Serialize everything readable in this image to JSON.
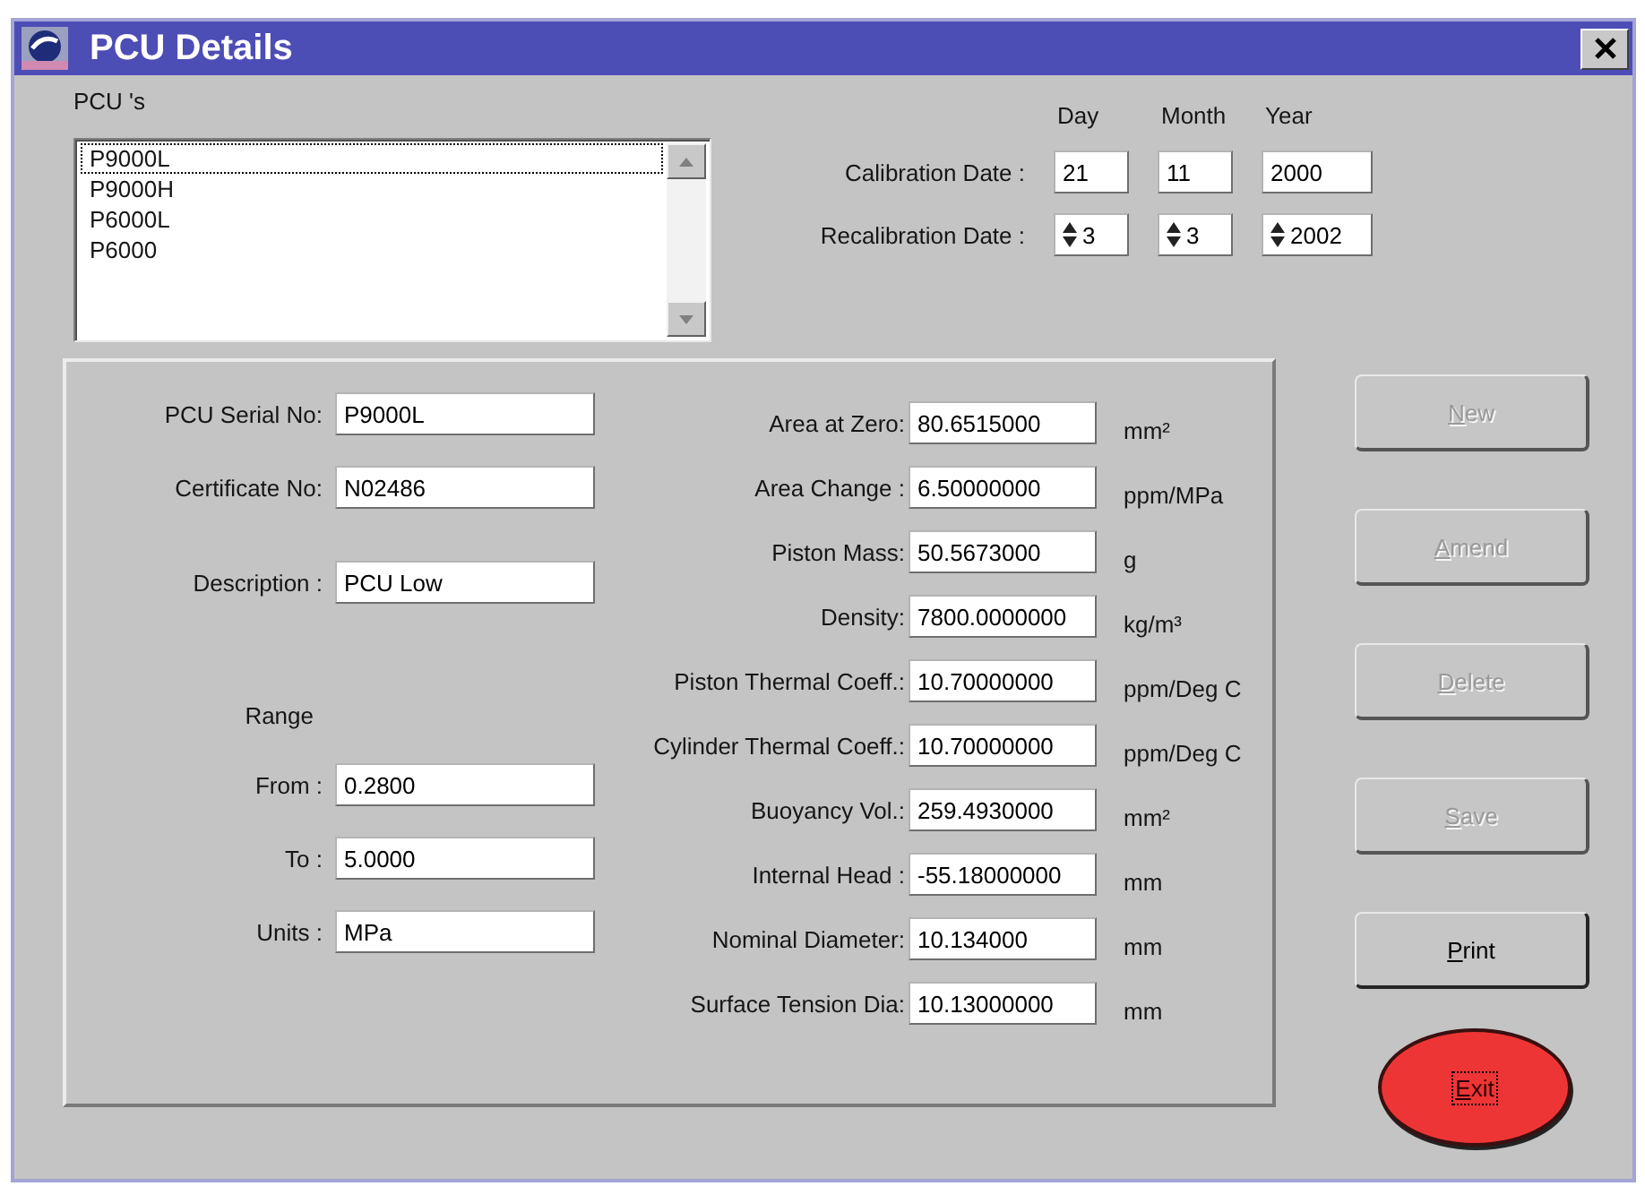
{
  "window": {
    "title": "PCU Details"
  },
  "pcu_list": {
    "label": "PCU 's",
    "items": [
      {
        "name": "P9000L",
        "selected": true
      },
      {
        "name": "P9000H",
        "selected": false
      },
      {
        "name": "P6000L",
        "selected": false
      },
      {
        "name": "P6000",
        "selected": false
      }
    ]
  },
  "dates": {
    "columns": [
      "Day",
      "Month",
      "Year"
    ],
    "rows": [
      {
        "label": "Calibration Date :",
        "kind": "text",
        "values": [
          "21",
          "11",
          "2000"
        ]
      },
      {
        "label": "Recalibration Date :",
        "kind": "spin",
        "values": [
          "3",
          "3",
          "2002"
        ]
      }
    ]
  },
  "details": {
    "left": [
      {
        "kind": "field",
        "label": "PCU Serial No:",
        "value": "P9000L"
      },
      {
        "kind": "field",
        "label": "Certificate No:",
        "value": "N02486"
      },
      {
        "kind": "field",
        "label": "Description :",
        "value": "PCU Low"
      },
      {
        "kind": "heading",
        "label": "Range"
      },
      {
        "kind": "field",
        "label": "From :",
        "value": "0.2800"
      },
      {
        "kind": "field",
        "label": "To :",
        "value": "5.0000"
      },
      {
        "kind": "field",
        "label": "Units :",
        "value": "MPa"
      }
    ],
    "right": [
      {
        "label": "Area at Zero:",
        "value": "80.6515000",
        "unit": "mm²"
      },
      {
        "label": "Area Change :",
        "value": "6.50000000",
        "unit": "ppm/MPa"
      },
      {
        "label": "Piston Mass:",
        "value": "50.5673000",
        "unit": "g"
      },
      {
        "label": "Density:",
        "value": "7800.0000000",
        "unit": "kg/m³"
      },
      {
        "label": "Piston Thermal Coeff.:",
        "value": "10.70000000",
        "unit": "ppm/Deg C"
      },
      {
        "label": "Cylinder Thermal Coeff.:",
        "value": "10.70000000",
        "unit": "ppm/Deg C"
      },
      {
        "label": "Buoyancy Vol.:",
        "value": "259.4930000",
        "unit": "mm²"
      },
      {
        "label": "Internal Head :",
        "value": "-55.18000000",
        "unit": "mm"
      },
      {
        "label": "Nominal Diameter:",
        "value": "10.134000",
        "unit": "mm"
      },
      {
        "label": "Surface Tension Dia:",
        "value": "10.13000000",
        "unit": "mm"
      }
    ]
  },
  "buttons": [
    {
      "label": "New",
      "kind": "rect",
      "disabled": true,
      "focused": false
    },
    {
      "label": "Amend",
      "kind": "rect",
      "disabled": true,
      "focused": false
    },
    {
      "label": "Delete",
      "kind": "rect",
      "disabled": true,
      "focused": false
    },
    {
      "label": "Save",
      "kind": "rect",
      "disabled": true,
      "focused": false
    },
    {
      "label": "Print",
      "kind": "rect",
      "disabled": false,
      "focused": false
    },
    {
      "label": "Exit",
      "kind": "oval",
      "disabled": false,
      "focused": true
    }
  ]
}
